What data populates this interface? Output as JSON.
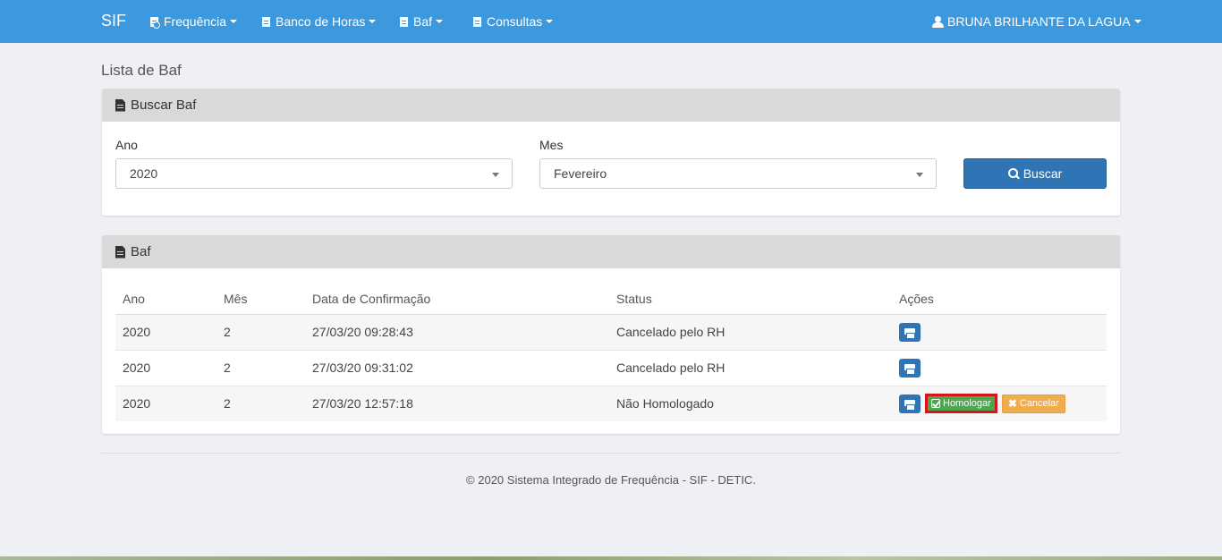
{
  "navbar": {
    "brand": "SIF",
    "items": [
      {
        "label": "Frequência"
      },
      {
        "label": "Banco de Horas"
      },
      {
        "label": "Baf"
      },
      {
        "label": "Consultas"
      }
    ],
    "user": "BRUNA BRILHANTE DA LAGUA"
  },
  "page": {
    "title": "Lista de Baf"
  },
  "search_panel": {
    "heading": "Buscar Baf",
    "ano_label": "Ano",
    "ano_value": "2020",
    "mes_label": "Mes",
    "mes_value": "Fevereiro",
    "button_label": "Buscar"
  },
  "results_panel": {
    "heading": "Baf",
    "columns": [
      "Ano",
      "Mês",
      "Data de Confirmação",
      "Status",
      "Ações"
    ],
    "rows": [
      {
        "ano": "2020",
        "mes": "2",
        "data": "27/03/20 09:28:43",
        "status": "Cancelado pelo RH"
      },
      {
        "ano": "2020",
        "mes": "2",
        "data": "27/03/20 09:31:02",
        "status": "Cancelado pelo RH"
      },
      {
        "ano": "2020",
        "mes": "2",
        "data": "27/03/20 12:57:18",
        "status": "Não Homologado"
      }
    ],
    "homologar_label": "Homologar",
    "cancelar_label": "Cancelar"
  },
  "footer": {
    "text": "© 2020 Sistema Integrado de Frequência - SIF - DETIC."
  },
  "colors": {
    "navbar": "#3c99dd",
    "primary_button": "#2f75b6",
    "success": "#4ca64c",
    "warning": "#f0ad4e",
    "highlight": "#d9141c"
  }
}
